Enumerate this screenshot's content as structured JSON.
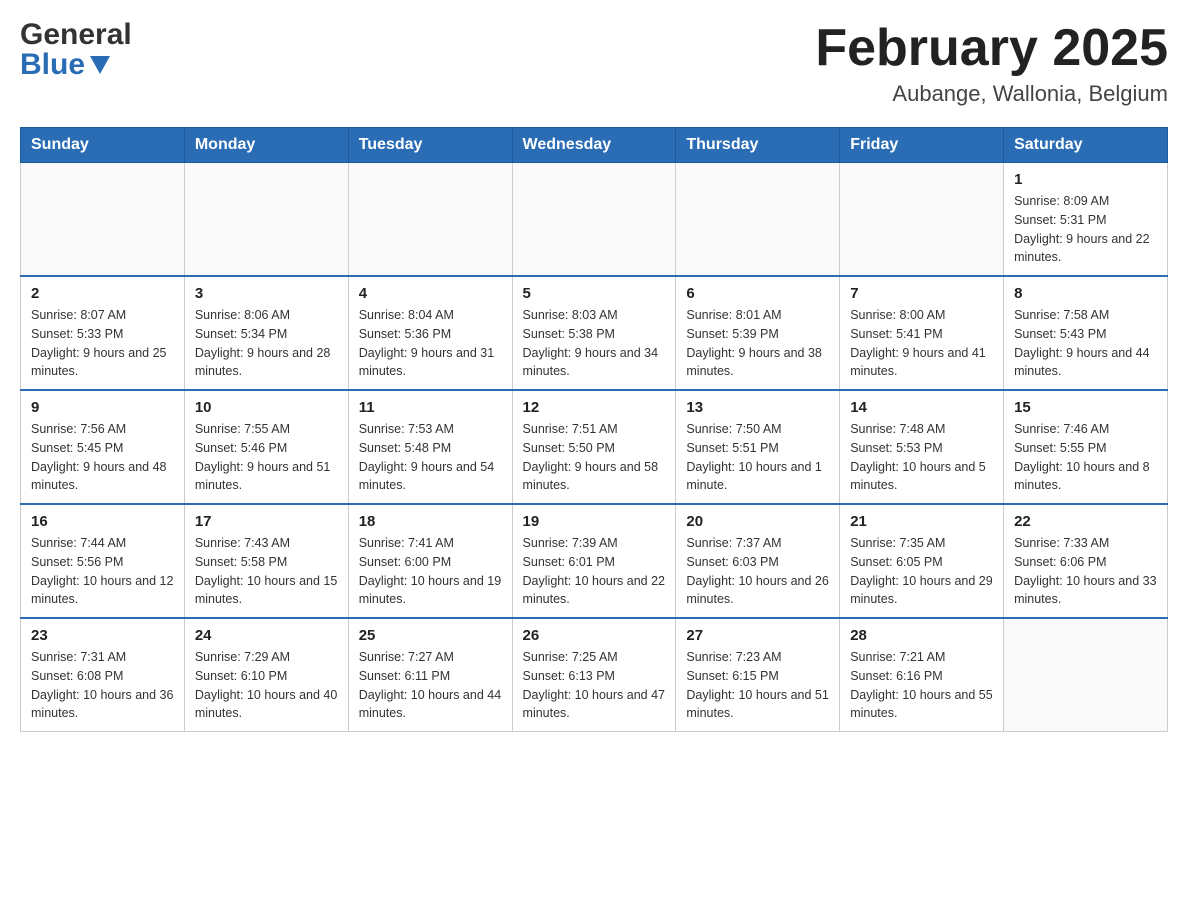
{
  "header": {
    "logo_general": "General",
    "logo_blue": "Blue",
    "month_title": "February 2025",
    "location": "Aubange, Wallonia, Belgium"
  },
  "weekdays": [
    "Sunday",
    "Monday",
    "Tuesday",
    "Wednesday",
    "Thursday",
    "Friday",
    "Saturday"
  ],
  "weeks": [
    [
      {
        "day": "",
        "info": ""
      },
      {
        "day": "",
        "info": ""
      },
      {
        "day": "",
        "info": ""
      },
      {
        "day": "",
        "info": ""
      },
      {
        "day": "",
        "info": ""
      },
      {
        "day": "",
        "info": ""
      },
      {
        "day": "1",
        "info": "Sunrise: 8:09 AM\nSunset: 5:31 PM\nDaylight: 9 hours and 22 minutes."
      }
    ],
    [
      {
        "day": "2",
        "info": "Sunrise: 8:07 AM\nSunset: 5:33 PM\nDaylight: 9 hours and 25 minutes."
      },
      {
        "day": "3",
        "info": "Sunrise: 8:06 AM\nSunset: 5:34 PM\nDaylight: 9 hours and 28 minutes."
      },
      {
        "day": "4",
        "info": "Sunrise: 8:04 AM\nSunset: 5:36 PM\nDaylight: 9 hours and 31 minutes."
      },
      {
        "day": "5",
        "info": "Sunrise: 8:03 AM\nSunset: 5:38 PM\nDaylight: 9 hours and 34 minutes."
      },
      {
        "day": "6",
        "info": "Sunrise: 8:01 AM\nSunset: 5:39 PM\nDaylight: 9 hours and 38 minutes."
      },
      {
        "day": "7",
        "info": "Sunrise: 8:00 AM\nSunset: 5:41 PM\nDaylight: 9 hours and 41 minutes."
      },
      {
        "day": "8",
        "info": "Sunrise: 7:58 AM\nSunset: 5:43 PM\nDaylight: 9 hours and 44 minutes."
      }
    ],
    [
      {
        "day": "9",
        "info": "Sunrise: 7:56 AM\nSunset: 5:45 PM\nDaylight: 9 hours and 48 minutes."
      },
      {
        "day": "10",
        "info": "Sunrise: 7:55 AM\nSunset: 5:46 PM\nDaylight: 9 hours and 51 minutes."
      },
      {
        "day": "11",
        "info": "Sunrise: 7:53 AM\nSunset: 5:48 PM\nDaylight: 9 hours and 54 minutes."
      },
      {
        "day": "12",
        "info": "Sunrise: 7:51 AM\nSunset: 5:50 PM\nDaylight: 9 hours and 58 minutes."
      },
      {
        "day": "13",
        "info": "Sunrise: 7:50 AM\nSunset: 5:51 PM\nDaylight: 10 hours and 1 minute."
      },
      {
        "day": "14",
        "info": "Sunrise: 7:48 AM\nSunset: 5:53 PM\nDaylight: 10 hours and 5 minutes."
      },
      {
        "day": "15",
        "info": "Sunrise: 7:46 AM\nSunset: 5:55 PM\nDaylight: 10 hours and 8 minutes."
      }
    ],
    [
      {
        "day": "16",
        "info": "Sunrise: 7:44 AM\nSunset: 5:56 PM\nDaylight: 10 hours and 12 minutes."
      },
      {
        "day": "17",
        "info": "Sunrise: 7:43 AM\nSunset: 5:58 PM\nDaylight: 10 hours and 15 minutes."
      },
      {
        "day": "18",
        "info": "Sunrise: 7:41 AM\nSunset: 6:00 PM\nDaylight: 10 hours and 19 minutes."
      },
      {
        "day": "19",
        "info": "Sunrise: 7:39 AM\nSunset: 6:01 PM\nDaylight: 10 hours and 22 minutes."
      },
      {
        "day": "20",
        "info": "Sunrise: 7:37 AM\nSunset: 6:03 PM\nDaylight: 10 hours and 26 minutes."
      },
      {
        "day": "21",
        "info": "Sunrise: 7:35 AM\nSunset: 6:05 PM\nDaylight: 10 hours and 29 minutes."
      },
      {
        "day": "22",
        "info": "Sunrise: 7:33 AM\nSunset: 6:06 PM\nDaylight: 10 hours and 33 minutes."
      }
    ],
    [
      {
        "day": "23",
        "info": "Sunrise: 7:31 AM\nSunset: 6:08 PM\nDaylight: 10 hours and 36 minutes."
      },
      {
        "day": "24",
        "info": "Sunrise: 7:29 AM\nSunset: 6:10 PM\nDaylight: 10 hours and 40 minutes."
      },
      {
        "day": "25",
        "info": "Sunrise: 7:27 AM\nSunset: 6:11 PM\nDaylight: 10 hours and 44 minutes."
      },
      {
        "day": "26",
        "info": "Sunrise: 7:25 AM\nSunset: 6:13 PM\nDaylight: 10 hours and 47 minutes."
      },
      {
        "day": "27",
        "info": "Sunrise: 7:23 AM\nSunset: 6:15 PM\nDaylight: 10 hours and 51 minutes."
      },
      {
        "day": "28",
        "info": "Sunrise: 7:21 AM\nSunset: 6:16 PM\nDaylight: 10 hours and 55 minutes."
      },
      {
        "day": "",
        "info": ""
      }
    ]
  ]
}
